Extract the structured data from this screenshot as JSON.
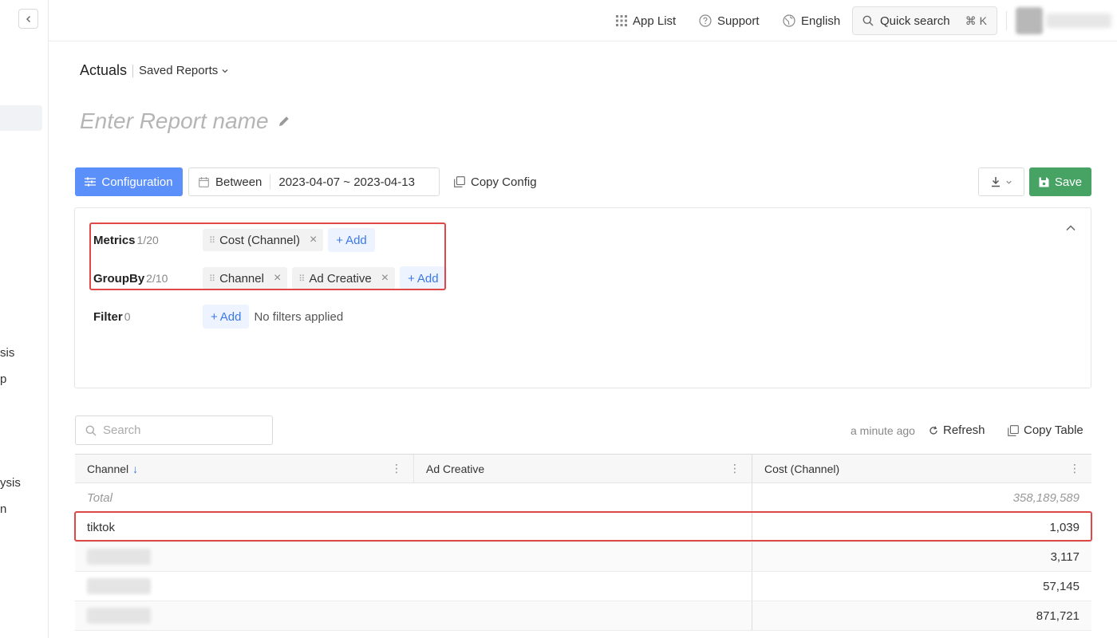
{
  "sidebar": {
    "fragments": [
      "sis",
      "p",
      "ysis",
      "n"
    ]
  },
  "topbar": {
    "app_list": "App List",
    "support": "Support",
    "language": "English",
    "quick_search": "Quick search",
    "shortcut": "⌘ K"
  },
  "breadcrumb": {
    "title": "Actuals",
    "saved_reports": "Saved Reports"
  },
  "report": {
    "name_placeholder": "Enter Report name"
  },
  "toolbar": {
    "configuration": "Configuration",
    "date_mode": "Between",
    "date_range": "2023-04-07 ~ 2023-04-13",
    "copy_config": "Copy Config",
    "save": "Save"
  },
  "config": {
    "metrics": {
      "label": "Metrics",
      "count": "1/20",
      "chips": [
        "Cost (Channel)"
      ],
      "add": "Add"
    },
    "groupby": {
      "label": "GroupBy",
      "count": "2/10",
      "chips": [
        "Channel",
        "Ad Creative"
      ],
      "add": "Add"
    },
    "filter": {
      "label": "Filter",
      "count": "0",
      "add": "Add",
      "empty": "No filters applied"
    }
  },
  "table_tools": {
    "search_placeholder": "Search",
    "updated": "a minute ago",
    "refresh": "Refresh",
    "copy_table": "Copy Table"
  },
  "table": {
    "columns": [
      "Channel",
      "Ad Creative",
      "Cost (Channel)"
    ],
    "total": {
      "label": "Total",
      "value": "358,189,589"
    },
    "rows": [
      {
        "channel": "tiktok",
        "value": "1,039"
      },
      {
        "channel": "",
        "value": "3,117"
      },
      {
        "channel": "",
        "value": "57,145"
      },
      {
        "channel": "",
        "value": "871,721"
      }
    ]
  },
  "colors": {
    "primary": "#5b8ff9",
    "save": "#47a363",
    "highlight": "#e04848",
    "link": "#3b78e7"
  }
}
